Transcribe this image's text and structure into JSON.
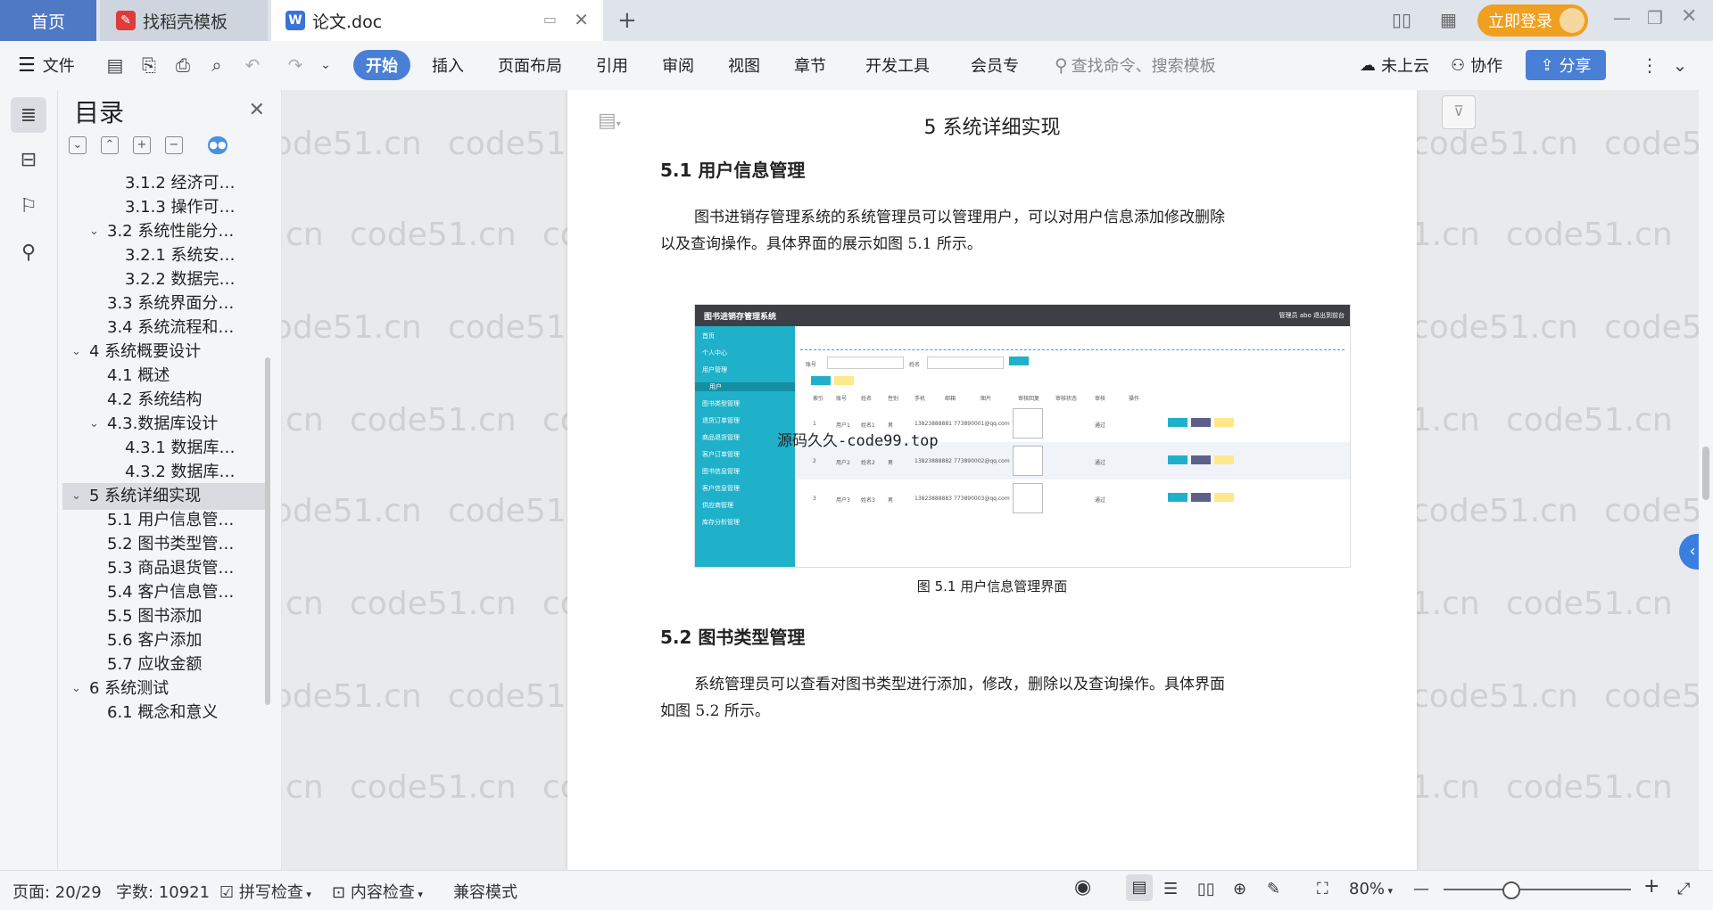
{
  "tabs": {
    "home": "首页",
    "template": "找稻壳模板",
    "doc": "论文.doc",
    "login": "立即登录"
  },
  "toolbar": {
    "file": "文件",
    "start": "开始",
    "insert": "插入",
    "layout": "页面布局",
    "references": "引用",
    "review": "审阅",
    "view": "视图",
    "chapter": "章节",
    "devtools": "开发工具",
    "member": "会员专",
    "search_placeholder": "查找命令、搜索模板",
    "cloud": "未上云",
    "collab": "协作",
    "share": "分享"
  },
  "toc": {
    "title": "目录",
    "items": [
      {
        "label": "3.1.2 经济可…",
        "level": 3
      },
      {
        "label": "3.1.3 操作可…",
        "level": 3
      },
      {
        "label": "3.2 系统性能分…",
        "level": 2,
        "expanded": true
      },
      {
        "label": "3.2.1 系统安…",
        "level": 3
      },
      {
        "label": "3.2.2 数据完…",
        "level": 3
      },
      {
        "label": "3.3 系统界面分…",
        "level": 2
      },
      {
        "label": "3.4 系统流程和…",
        "level": 2
      },
      {
        "label": "4 系统概要设计",
        "level": 1,
        "expanded": true
      },
      {
        "label": "4.1 概述",
        "level": 2
      },
      {
        "label": "4.2 系统结构",
        "level": 2
      },
      {
        "label": "4.3.数据库设计",
        "level": 2,
        "expanded": true
      },
      {
        "label": "4.3.1 数据库…",
        "level": 3
      },
      {
        "label": "4.3.2 数据库…",
        "level": 3
      },
      {
        "label": "5 系统详细实现",
        "level": 1,
        "expanded": true,
        "active": true
      },
      {
        "label": "5.1 用户信息管…",
        "level": 2
      },
      {
        "label": "5.2 图书类型管…",
        "level": 2
      },
      {
        "label": "5.3 商品退货管…",
        "level": 2
      },
      {
        "label": "5.4 客户信息管…",
        "level": 2
      },
      {
        "label": "5.5 图书添加",
        "level": 2
      },
      {
        "label": "5.6 客户添加",
        "level": 2
      },
      {
        "label": "5.7 应收金额",
        "level": 2
      },
      {
        "label": "6 系统测试",
        "level": 1,
        "expanded": true
      },
      {
        "label": "6.1 概念和意义",
        "level": 2
      }
    ]
  },
  "watermark": "code51.cn",
  "doc": {
    "chapter_title": "5 系统详细实现",
    "s1_title": "5.1  用户信息管理",
    "s1_para_line1": "图书进销存管理系统的系统管理员可以管理用户，可以对用户信息添加修改删除",
    "s1_para_line2": "以及查询操作。具体界面的展示如图 5.1 所示。",
    "figure_caption": "图 5.1  用户信息管理界面",
    "s2_title": "5.2  图书类型管理",
    "s2_para_line1": "系统管理员可以查看对图书类型进行添加，修改，删除以及查询操作。具体界面",
    "s2_para_line2": "如图 5.2 所示。",
    "overlay_watermark": "源码久久-code99.top"
  },
  "shot": {
    "app_title": "图书进销存管理系统",
    "top_right": "管理员 abo    退出到前台",
    "menu": [
      "首页",
      "个人中心",
      "用户管理",
      "用户",
      "图书类型管理",
      "退货订单管理",
      "商品退货管理",
      "客户订单管理",
      "图书信息管理",
      "客户信息管理",
      "供应商管理",
      "库存分析管理"
    ],
    "columns": [
      "索引",
      "账号",
      "姓名",
      "性别",
      "手机",
      "邮箱",
      "图片",
      "审核回复",
      "审核状态",
      "审核",
      "操作"
    ],
    "rows": [
      {
        "idx": "1",
        "acct": "用户1",
        "name": "姓名1",
        "sex": "男",
        "phone": "13823888881",
        "mail": "773890001@qq.com",
        "status": "通过"
      },
      {
        "idx": "2",
        "acct": "用户2",
        "name": "姓名2",
        "sex": "男",
        "phone": "13823888882",
        "mail": "773890002@qq.com",
        "status": "通过"
      },
      {
        "idx": "3",
        "acct": "用户3",
        "name": "姓名3",
        "sex": "男",
        "phone": "13823888883",
        "mail": "773890003@qq.com",
        "status": "通过"
      }
    ],
    "search_label1": "账号",
    "search_label2": "姓名"
  },
  "status": {
    "page": "页面: 20/29",
    "words": "字数: 10921",
    "spell": "拼写检查",
    "content": "内容检查",
    "compat": "兼容模式",
    "zoom": "80%"
  }
}
